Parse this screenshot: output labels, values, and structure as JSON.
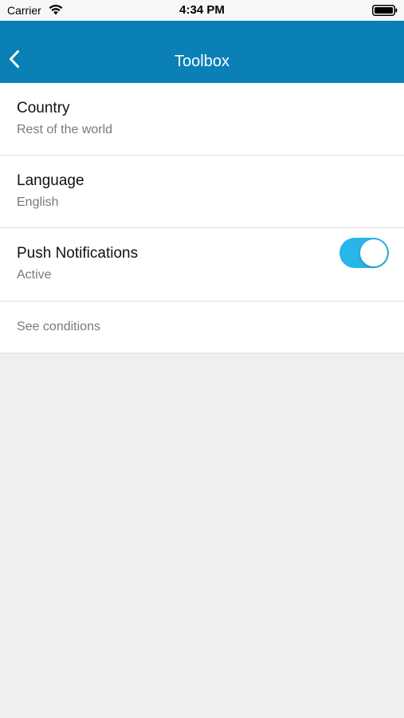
{
  "status_bar": {
    "carrier": "Carrier",
    "time": "4:34 PM",
    "wifi_icon": "wifi-icon",
    "battery_icon": "battery-icon"
  },
  "nav": {
    "title": "Toolbox",
    "back_icon": "chevron-left-icon",
    "background_color": "#0a80b7"
  },
  "settings": {
    "country": {
      "title": "Country",
      "value": "Rest of the world"
    },
    "language": {
      "title": "Language",
      "value": "English"
    },
    "push": {
      "title": "Push Notifications",
      "status": "Active",
      "enabled": true,
      "toggle_color": "#27b5ea"
    },
    "conditions_label": "See conditions"
  }
}
